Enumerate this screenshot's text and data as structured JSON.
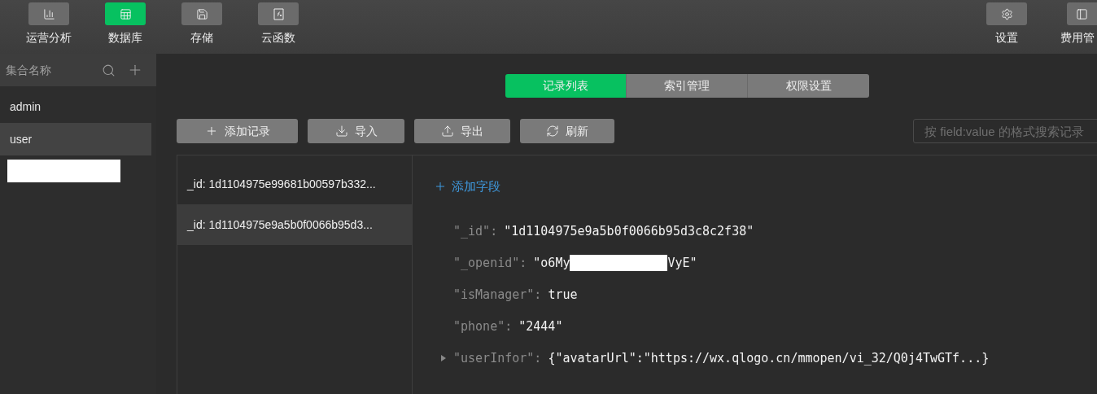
{
  "toolbar": {
    "left": [
      {
        "label": "运营分析",
        "selected": false
      },
      {
        "label": "数据库",
        "selected": true
      },
      {
        "label": "存储",
        "selected": false
      },
      {
        "label": "云函数",
        "selected": false
      }
    ],
    "right": [
      {
        "label": "设置",
        "selected": false
      },
      {
        "label": "费用管",
        "selected": false
      }
    ]
  },
  "sidebar": {
    "title": "集合名称",
    "items": [
      {
        "kind": "text",
        "label": "admin",
        "selected": false
      },
      {
        "kind": "text",
        "label": "user",
        "selected": true
      },
      {
        "kind": "redacted",
        "selected": false
      }
    ]
  },
  "tabs": [
    {
      "label": "记录列表",
      "selected": true
    },
    {
      "label": "索引管理",
      "selected": false
    },
    {
      "label": "权限设置",
      "selected": false
    }
  ],
  "actions": [
    {
      "label": "添加记录"
    },
    {
      "label": "导入"
    },
    {
      "label": "导出"
    },
    {
      "label": "刷新"
    }
  ],
  "search": {
    "placeholder": "按 field:value 的格式搜索记录"
  },
  "records": [
    {
      "label": "_id: 1d1104975e99681b00597b332...",
      "selected": false
    },
    {
      "label": "_id: 1d1104975e9a5b0f0066b95d3...",
      "selected": true
    }
  ],
  "detail": {
    "add_field": "添加字段",
    "fields": [
      {
        "kind": "plain",
        "key": "\"_id\":",
        "value": "\"1d1104975e9a5b0f0066b95d3c8c2f38\"",
        "expandable": false
      },
      {
        "kind": "redacted",
        "key": "\"_openid\":",
        "value_start": "\"o6My",
        "value_end": "VyE\"",
        "expandable": false
      },
      {
        "kind": "plain",
        "key": "\"isManager\":",
        "value": "true",
        "expandable": false
      },
      {
        "kind": "plain",
        "key": "\"phone\":",
        "value": "\"2444\"",
        "expandable": false
      },
      {
        "kind": "plain",
        "key": "\"userInfor\":",
        "value": "{\"avatarUrl\":\"https://wx.qlogo.cn/mmopen/vi_32/Q0j4TwGTf...}",
        "expandable": true
      }
    ]
  }
}
